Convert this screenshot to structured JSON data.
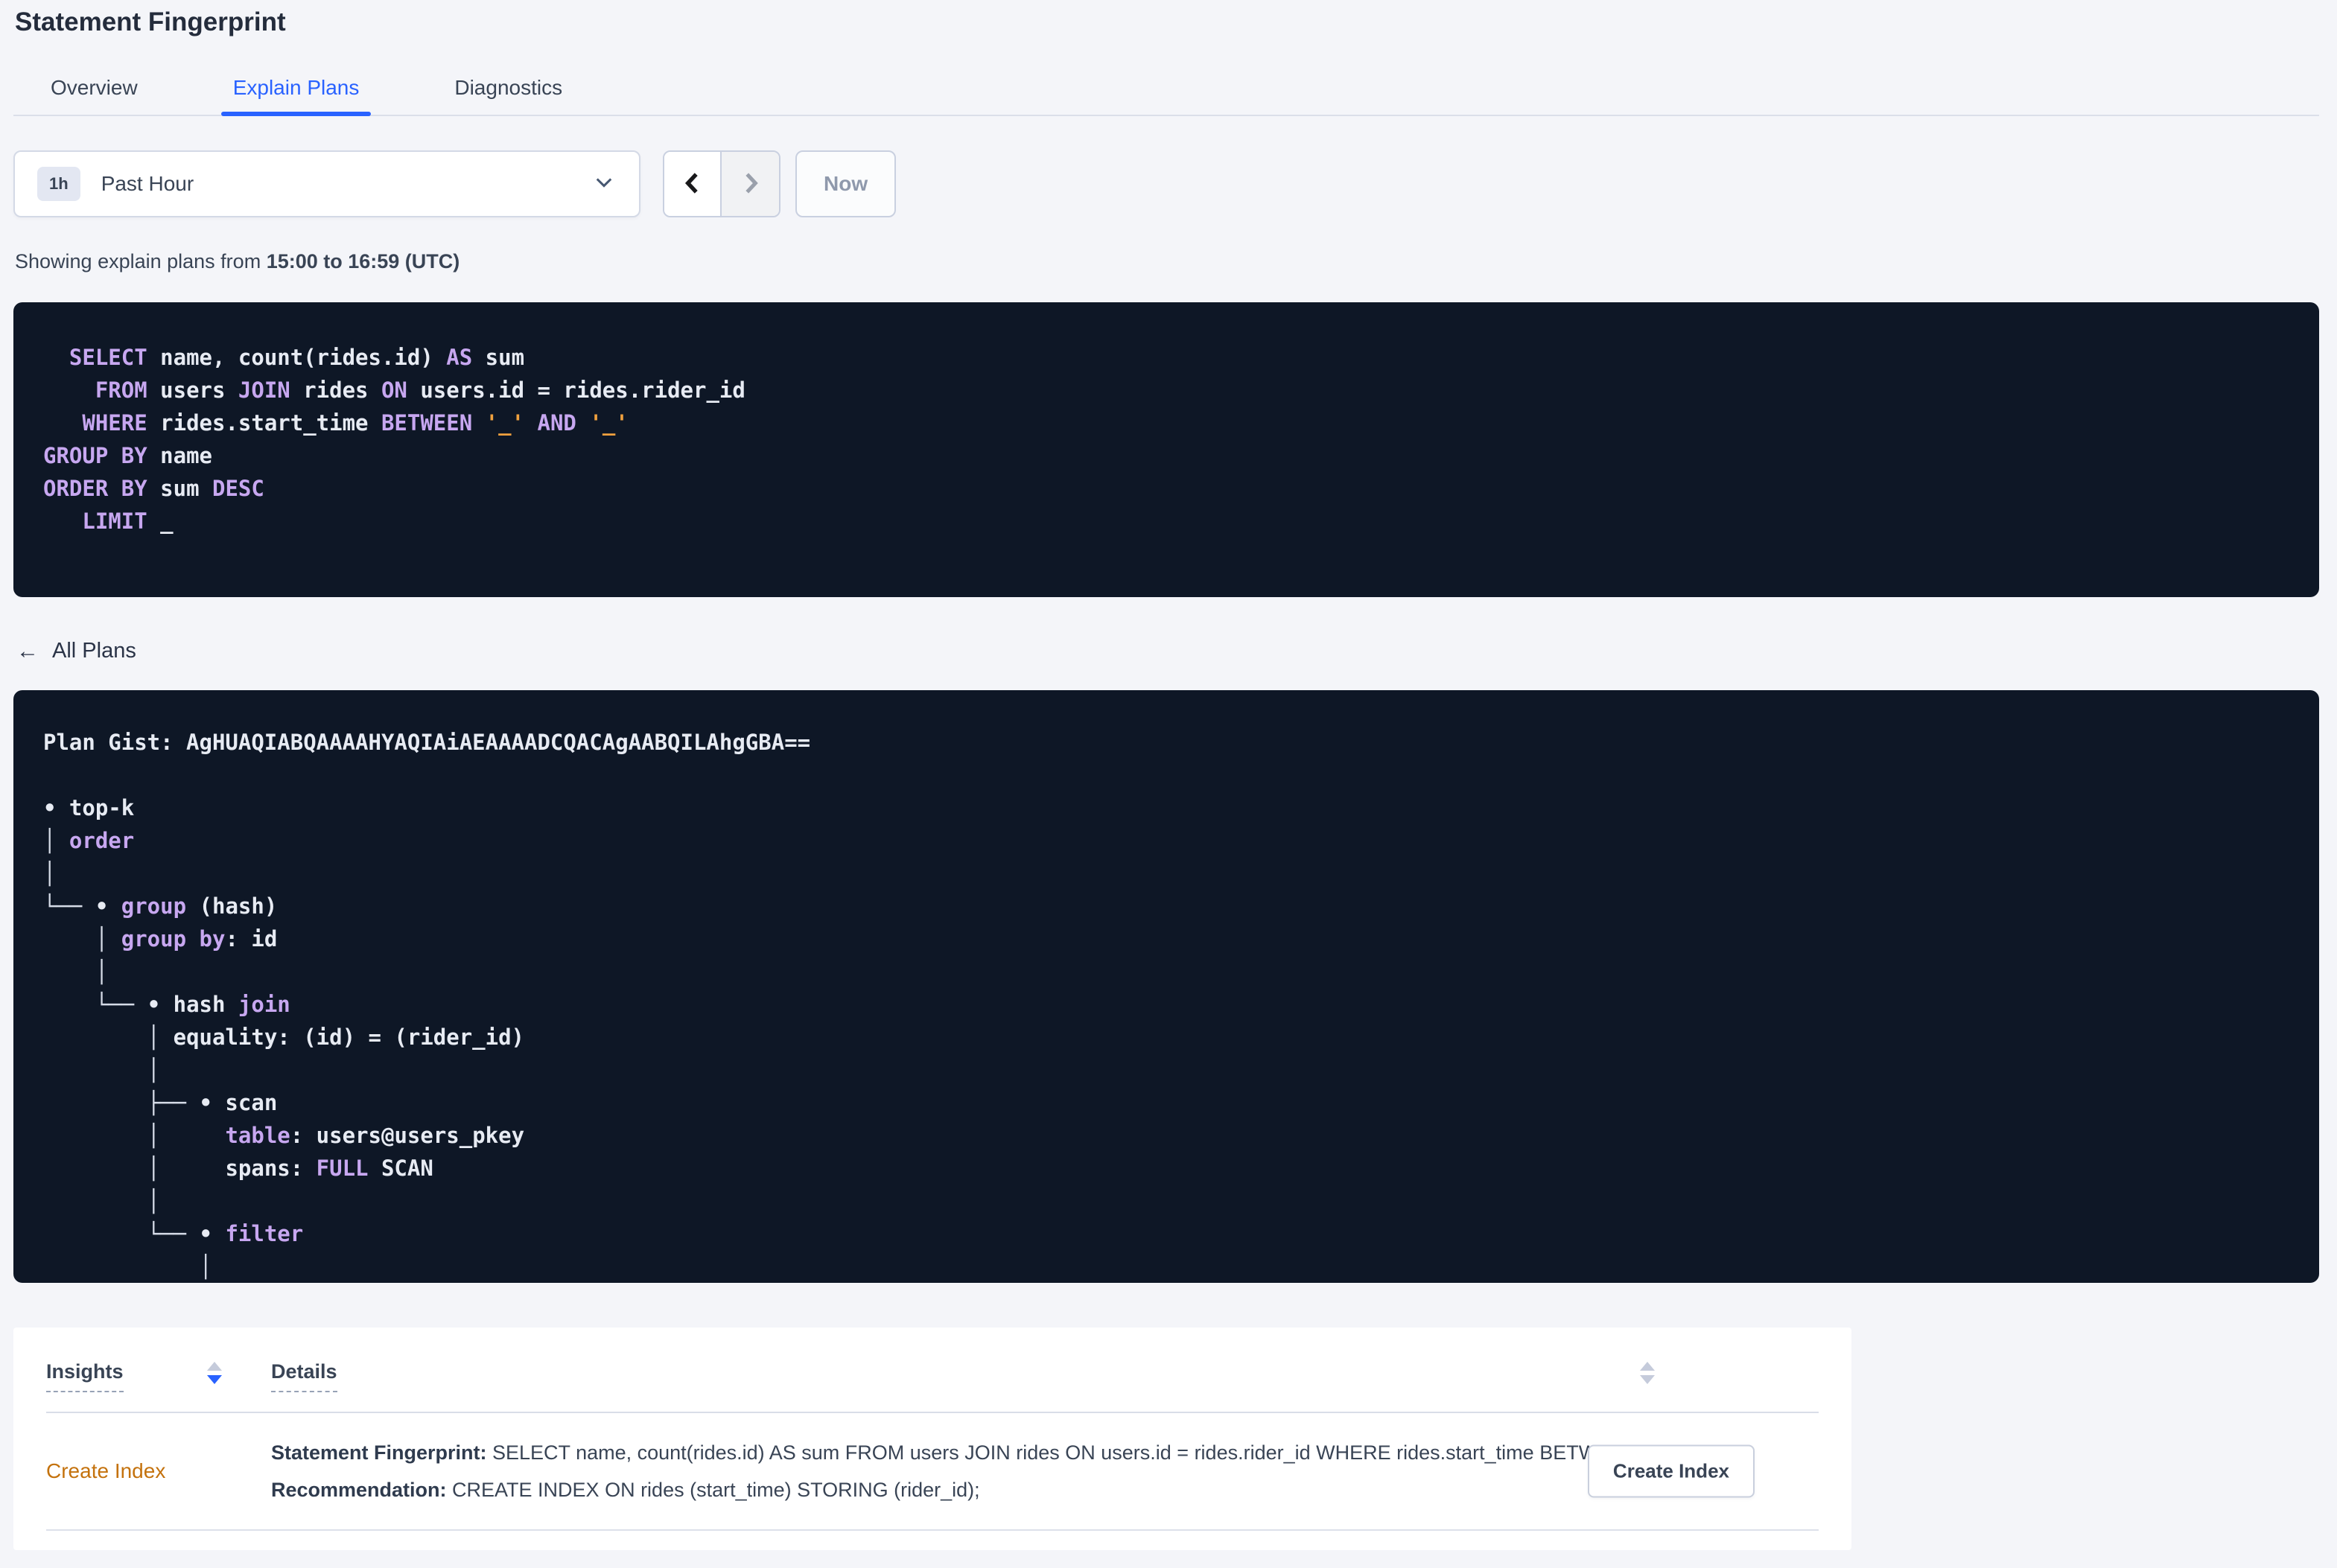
{
  "page": {
    "title": "Statement Fingerprint"
  },
  "tabs": [
    {
      "label": "Overview",
      "active": false
    },
    {
      "label": "Explain Plans",
      "active": true
    },
    {
      "label": "Diagnostics",
      "active": false
    }
  ],
  "time_controls": {
    "range_badge": "1h",
    "range_label": "Past Hour",
    "now_label": "Now"
  },
  "caption": {
    "prefix": "Showing explain plans from ",
    "range": "15:00 to 16:59 (UTC)"
  },
  "sql_block": {
    "lines": [
      [
        {
          "t": "  SELECT",
          "c": "k"
        },
        {
          "t": " name, count(rides.id) ",
          "c": "w"
        },
        {
          "t": "AS",
          "c": "k"
        },
        {
          "t": " sum",
          "c": "w"
        }
      ],
      [
        {
          "t": "    FROM",
          "c": "k"
        },
        {
          "t": " users ",
          "c": "w"
        },
        {
          "t": "JOIN",
          "c": "k"
        },
        {
          "t": " rides ",
          "c": "w"
        },
        {
          "t": "ON",
          "c": "k"
        },
        {
          "t": " users.id = rides.rider_id",
          "c": "w"
        }
      ],
      [
        {
          "t": "   WHERE",
          "c": "k"
        },
        {
          "t": " rides.start_time ",
          "c": "w"
        },
        {
          "t": "BETWEEN",
          "c": "k"
        },
        {
          "t": " ",
          "c": "w"
        },
        {
          "t": "'_'",
          "c": "o"
        },
        {
          "t": " ",
          "c": "w"
        },
        {
          "t": "AND",
          "c": "k"
        },
        {
          "t": " ",
          "c": "w"
        },
        {
          "t": "'_'",
          "c": "o"
        }
      ],
      [
        {
          "t": "GROUP BY",
          "c": "k"
        },
        {
          "t": " name",
          "c": "w"
        }
      ],
      [
        {
          "t": "ORDER BY",
          "c": "k"
        },
        {
          "t": " sum ",
          "c": "w"
        },
        {
          "t": "DESC",
          "c": "k"
        }
      ],
      [
        {
          "t": "   LIMIT",
          "c": "k"
        },
        {
          "t": " _",
          "c": "w"
        }
      ]
    ]
  },
  "all_plans_link": {
    "icon": "←",
    "label": "All Plans"
  },
  "plan_block": {
    "gist_label": "Plan Gist:",
    "gist": "AgHUAQIABQAAAAHYAQIAiAEAAAADCQACAgAABQILAhgGBA==",
    "lines": [
      [
        {
          "t": "Plan Gist: AgHUAQIABQAAAAHYAQIAiAEAAAADCQACAgAABQILAhgGBA==",
          "c": "w"
        }
      ],
      [],
      [
        {
          "t": "• top-k",
          "c": "w"
        }
      ],
      [
        {
          "t": "│ ",
          "c": "l"
        },
        {
          "t": "order",
          "c": "k"
        }
      ],
      [
        {
          "t": "│",
          "c": "l"
        }
      ],
      [
        {
          "t": "└── ",
          "c": "l"
        },
        {
          "t": "• ",
          "c": "w"
        },
        {
          "t": "group",
          "c": "k"
        },
        {
          "t": " (hash)",
          "c": "w"
        }
      ],
      [
        {
          "t": "    │ ",
          "c": "l"
        },
        {
          "t": "group by",
          "c": "k"
        },
        {
          "t": ": id",
          "c": "w"
        }
      ],
      [
        {
          "t": "    │",
          "c": "l"
        }
      ],
      [
        {
          "t": "    └── ",
          "c": "l"
        },
        {
          "t": "• hash ",
          "c": "w"
        },
        {
          "t": "join",
          "c": "k"
        }
      ],
      [
        {
          "t": "        │ ",
          "c": "l"
        },
        {
          "t": "equality: (id) = (rider_id)",
          "c": "w"
        }
      ],
      [
        {
          "t": "        │",
          "c": "l"
        }
      ],
      [
        {
          "t": "        ├── ",
          "c": "l"
        },
        {
          "t": "• scan",
          "c": "w"
        }
      ],
      [
        {
          "t": "        │",
          "c": "l"
        },
        {
          "t": "     ",
          "c": "w"
        },
        {
          "t": "table",
          "c": "k"
        },
        {
          "t": ": users@users_pkey",
          "c": "w"
        }
      ],
      [
        {
          "t": "        │",
          "c": "l"
        },
        {
          "t": "     spans: ",
          "c": "w"
        },
        {
          "t": "FULL",
          "c": "k"
        },
        {
          "t": " SCAN",
          "c": "w"
        }
      ],
      [
        {
          "t": "        │",
          "c": "l"
        }
      ],
      [
        {
          "t": "        └── ",
          "c": "l"
        },
        {
          "t": "• ",
          "c": "w"
        },
        {
          "t": "filter",
          "c": "k"
        }
      ],
      [
        {
          "t": "            │",
          "c": "l"
        }
      ]
    ]
  },
  "insights_table": {
    "columns": [
      {
        "label": "Insights",
        "sort": "desc"
      },
      {
        "label": "Details",
        "sort": "none"
      }
    ],
    "row": {
      "insight_type": "Create Index",
      "statement_label": "Statement Fingerprint:",
      "statement_text": " SELECT name, count(rides.id) AS sum FROM users JOIN rides ON users.id = rides.rider_id WHERE rides.start_time BETWEEN '_…",
      "recommendation_label": "Recommendation:",
      "recommendation_text": " CREATE INDEX ON rides (start_time) STORING (rider_id);",
      "action_label": "Create Index"
    }
  },
  "colors": {
    "accent_blue": "#2962ff",
    "code_keyword_purple": "#c7a7f0",
    "code_literal_orange": "#f0a13e",
    "code_text": "#e7ebf3",
    "code_block_bg": "#0e1726",
    "insight_orange": "#c4720d",
    "page_bg": "#f4f5f9"
  }
}
